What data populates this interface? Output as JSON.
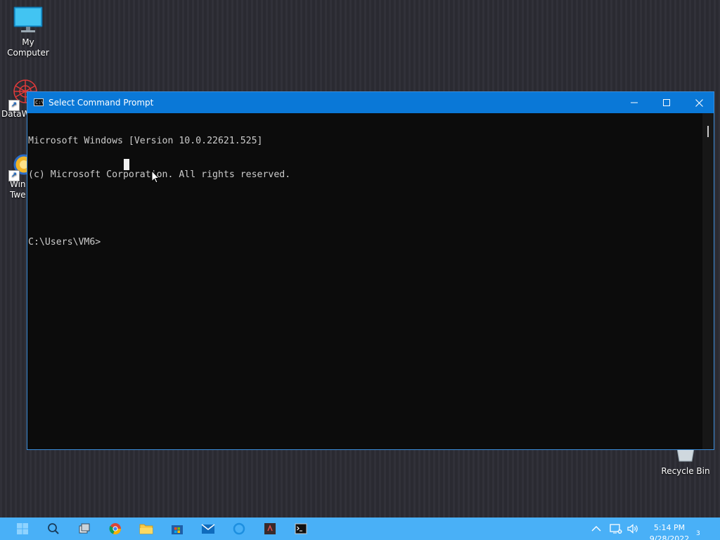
{
  "desktop": {
    "icons": [
      {
        "label": "My Computer",
        "icon": "monitor-icon"
      },
      {
        "label": "DataW",
        "icon": "datawrapper-icon"
      },
      {
        "label": "Win\nTwe",
        "icon": "wintweaker-icon"
      },
      {
        "label": "Recycle Bin",
        "icon": "recycle-bin-icon"
      }
    ]
  },
  "cmd_window": {
    "title": "Select Command Prompt",
    "icon_text": "C:\\",
    "lines": [
      "Microsoft Windows [Version 10.0.22621.525]",
      "(c) Microsoft Corporation. All rights reserved.",
      "",
      "C:\\Users\\VM6>"
    ],
    "controls": [
      "minimize",
      "maximize",
      "close"
    ]
  },
  "taskbar": {
    "apps": [
      "start",
      "search",
      "task-view",
      "chrome",
      "file-explorer",
      "microsoft-store",
      "mail",
      "cortana",
      "app",
      "command-prompt"
    ],
    "tray": {
      "time": "5:14 PM",
      "date": "9/28/2022",
      "notification_count": "3"
    }
  },
  "colors": {
    "titlebar": "#0a78d7",
    "taskbar": "#49b0f7",
    "console_bg": "#0c0c0c",
    "console_fg": "#cccccc"
  }
}
